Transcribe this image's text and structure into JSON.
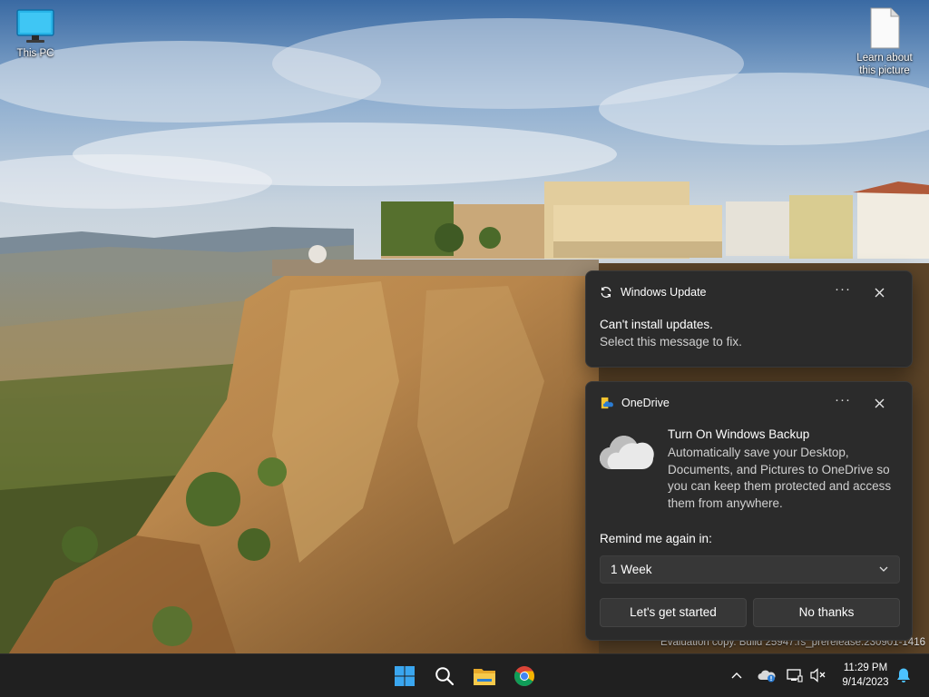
{
  "desktop": {
    "icons": [
      {
        "label": "This PC",
        "icon": "monitor-icon"
      },
      {
        "label": "Learn about this picture",
        "icon": "document-icon"
      }
    ],
    "watermark": "Evaluation copy. Build 25947.rs_prerelease.230901-1416"
  },
  "notifications": [
    {
      "app": "Windows Update",
      "app_icon": "sync-icon",
      "title": "Can't install updates.",
      "body": "Select this message to fix.",
      "more_label": "···",
      "close_icon": "close-icon"
    },
    {
      "app": "OneDrive",
      "app_icon": "onedrive-icon",
      "title": "Turn On Windows Backup",
      "body": "Automatically save your Desktop, Documents, and Pictures to OneDrive so you can keep them protected and access them from anywhere.",
      "remind_label": "Remind me again in:",
      "remind_value": "1 Week",
      "primary_button": "Let's get started",
      "secondary_button": "No thanks",
      "more_label": "···",
      "close_icon": "close-icon"
    }
  ],
  "taskbar": {
    "apps": [
      "start-icon",
      "search-icon",
      "file-explorer-icon",
      "chrome-icon"
    ],
    "tray": [
      "chevron-up-icon",
      "onedrive-icon",
      "network-icon",
      "volume-muted-icon",
      "bell-icon"
    ],
    "time": "11:29 PM",
    "date": "9/14/2023"
  },
  "colors": {
    "toast_bg": "#2b2b2b",
    "taskbar_bg": "#202020",
    "accent": "#0078d4"
  }
}
